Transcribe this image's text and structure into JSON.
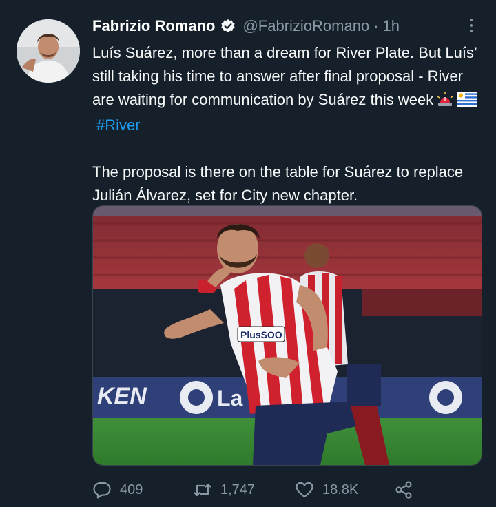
{
  "tweet": {
    "author_name": "Fabrizio Romano",
    "handle": "@FabrizioRomano",
    "separator": "·",
    "time": "1h",
    "text_line1": "Luís Suárez, more than a dream for River Plate. But Luís’ still taking his time to answer after final proposal - River are waiting for communication by Suárez this week",
    "hashtag": "#River",
    "text_para2": "The proposal is there on the table for Suárez to replace Julián Álvarez, set for City new chapter.",
    "media_texts": {
      "sponsor": "PlusSOO",
      "brand": "KEN",
      "league": "La"
    }
  },
  "actions": {
    "replies": "409",
    "retweets": "1,747",
    "likes": "18.8K"
  },
  "colors": {
    "background": "#15202b",
    "accent": "#1d9bf0",
    "muted": "#8b98a5"
  },
  "icons": [
    "verified-badge-icon",
    "more-icon",
    "siren-emoji-icon",
    "uruguay-flag-icon",
    "reply-icon",
    "retweet-icon",
    "like-icon",
    "share-icon"
  ]
}
